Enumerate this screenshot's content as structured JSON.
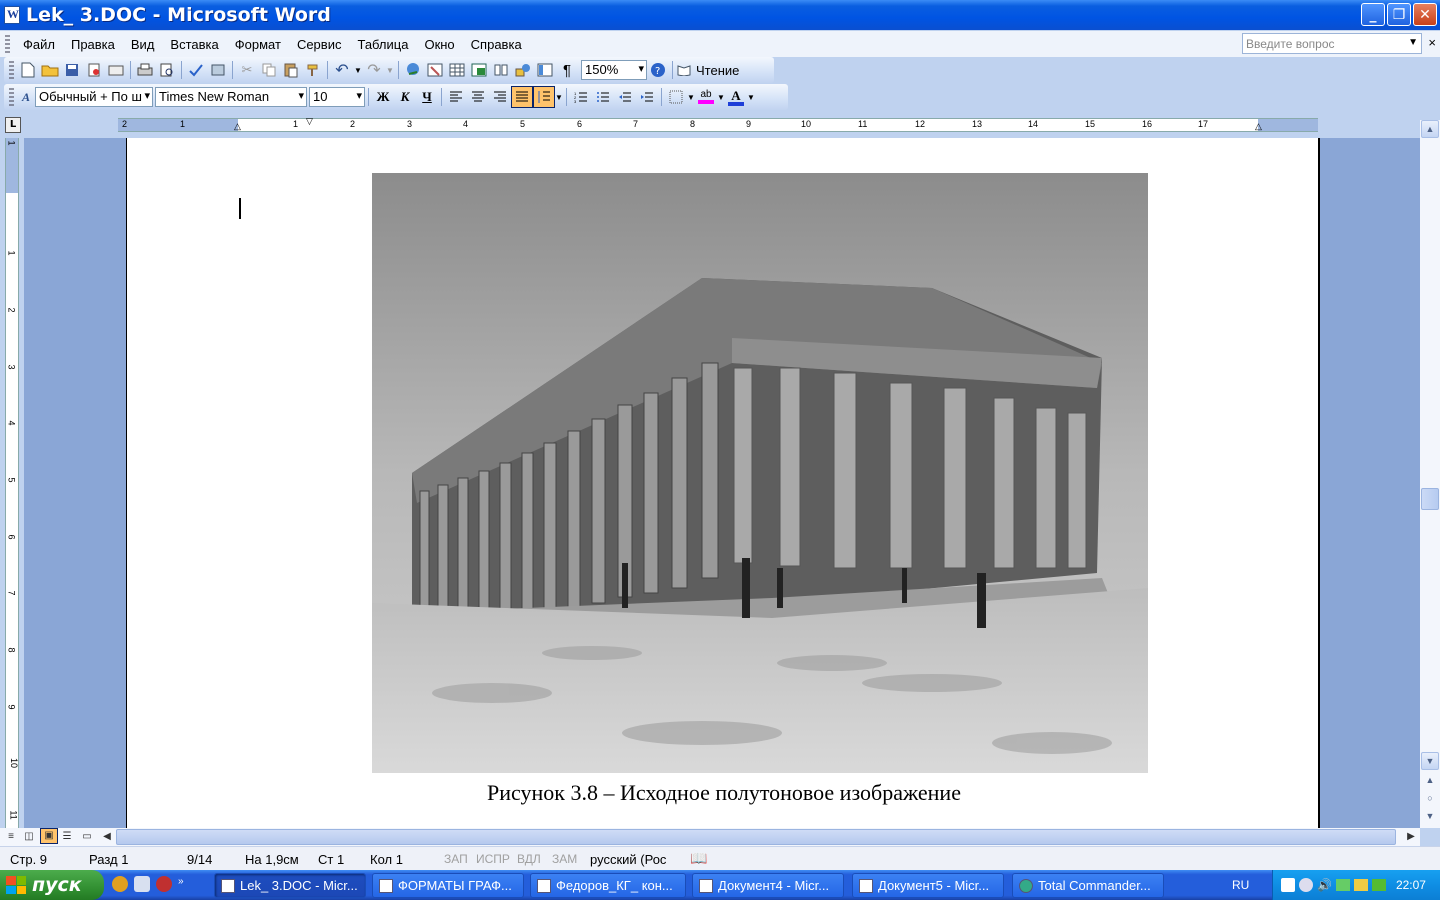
{
  "window": {
    "title": "Lek_ 3.DOC - Microsoft Word",
    "buttons": {
      "minimize": "_",
      "restore": "❐",
      "close": "✕"
    }
  },
  "menubar": {
    "items": [
      "Файл",
      "Правка",
      "Вид",
      "Вставка",
      "Формат",
      "Сервис",
      "Таблица",
      "Окно",
      "Справка"
    ],
    "ask_placeholder": "Введите вопрос",
    "close": "×"
  },
  "toolbar_standard": {
    "zoom": "150%",
    "reading_label": "Чтение"
  },
  "toolbar_format": {
    "style": "Обычный + По ш",
    "font": "Times New Roman",
    "size": "10",
    "bold": "Ж",
    "italic": "К",
    "underline": "Ч",
    "font_color_letter": "A",
    "highlight_letters": "ab"
  },
  "ruler": {
    "h_numbers": [
      "2",
      "1",
      "1",
      "2",
      "3",
      "4",
      "5",
      "6",
      "7",
      "8",
      "9",
      "10",
      "11",
      "12",
      "13",
      "14",
      "15",
      "16",
      "17"
    ],
    "v_numbers": [
      "1",
      "1",
      "2",
      "3",
      "4",
      "5",
      "6",
      "7",
      "8",
      "9",
      "10",
      "11"
    ]
  },
  "document": {
    "caption": "Рисунок 3.8 – Исходное полутоновое изображение"
  },
  "statusbar": {
    "page": "Стр. 9",
    "section": "Разд 1",
    "pages": "9/14",
    "at": "На 1,9см",
    "line": "Ст 1",
    "col": "Кол 1",
    "rec": "ЗАП",
    "trk": "ИСПР",
    "ext": "ВДЛ",
    "ovr": "ЗАМ",
    "language": "русский (Рос"
  },
  "taskbar": {
    "start_label": "пуск",
    "tasks": [
      {
        "label": "Lek_ 3.DOC - Micr...",
        "active": true
      },
      {
        "label": "ФОРМАТЫ ГРАФ...",
        "active": false
      },
      {
        "label": "Федоров_КГ_ кон...",
        "active": false
      },
      {
        "label": "Документ4 - Micr...",
        "active": false
      },
      {
        "label": "Документ5 - Micr...",
        "active": false
      },
      {
        "label": "Total Commander...",
        "active": false
      }
    ],
    "language": "RU",
    "time": "22:07"
  },
  "colors": {
    "titlebar": "#0054e3",
    "taskbar": "#245edb",
    "start": "#2e8b2e",
    "page_bg": "#8aa6d6"
  }
}
